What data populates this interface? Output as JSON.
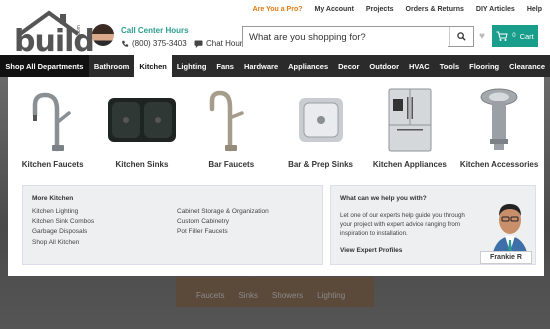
{
  "utility": {
    "links": [
      "Are You a Pro?",
      "My Account",
      "Projects",
      "Orders & Returns",
      "DIY Articles",
      "Help"
    ]
  },
  "logo": {
    "word": "build",
    "suffix": ".com"
  },
  "contact": {
    "title": "Call Center Hours",
    "phone": "(800) 375-3403",
    "chat": "Chat Hours"
  },
  "search": {
    "placeholder": "What are you shopping for?"
  },
  "cart": {
    "count": "0",
    "label": "Cart"
  },
  "nav": {
    "all": "Shop All Departments",
    "items": [
      "Bathroom",
      "Kitchen",
      "Lighting",
      "Fans",
      "Hardware",
      "Appliances",
      "Decor",
      "Outdoor",
      "HVAC",
      "Tools",
      "Flooring",
      "Clearance"
    ],
    "active": "Kitchen"
  },
  "categories": [
    {
      "label": "Kitchen Faucets",
      "icon": "kitchen-faucet-icon"
    },
    {
      "label": "Kitchen Sinks",
      "icon": "kitchen-sink-icon"
    },
    {
      "label": "Bar Faucets",
      "icon": "bar-faucet-icon"
    },
    {
      "label": "Bar & Prep Sinks",
      "icon": "bar-sink-icon"
    },
    {
      "label": "Kitchen Appliances",
      "icon": "refrigerator-icon"
    },
    {
      "label": "Kitchen Accessories",
      "icon": "drain-strainer-icon"
    }
  ],
  "more_kitchen": {
    "heading": "More Kitchen",
    "col1": [
      "Kitchen Lighting",
      "Kitchen Sink Combos",
      "Garbage Disposals",
      "Shop All Kitchen"
    ],
    "col2": [
      "Cabinet Storage & Organization",
      "Custom Cabinetry",
      "Pot Filler Faucets"
    ]
  },
  "help": {
    "heading": "What can we help you with?",
    "text": "Let one of our experts help guide you through your project with expert advice ranging from inspiration to installation.",
    "link": "View Expert Profiles",
    "expert_name": "Frankie R"
  },
  "background_tabs": [
    "Faucets",
    "Sinks",
    "Showers",
    "Lighting"
  ],
  "colors": {
    "accent": "#1a9e8c",
    "pro": "#e07a10",
    "nav": "#2b2b2b"
  }
}
